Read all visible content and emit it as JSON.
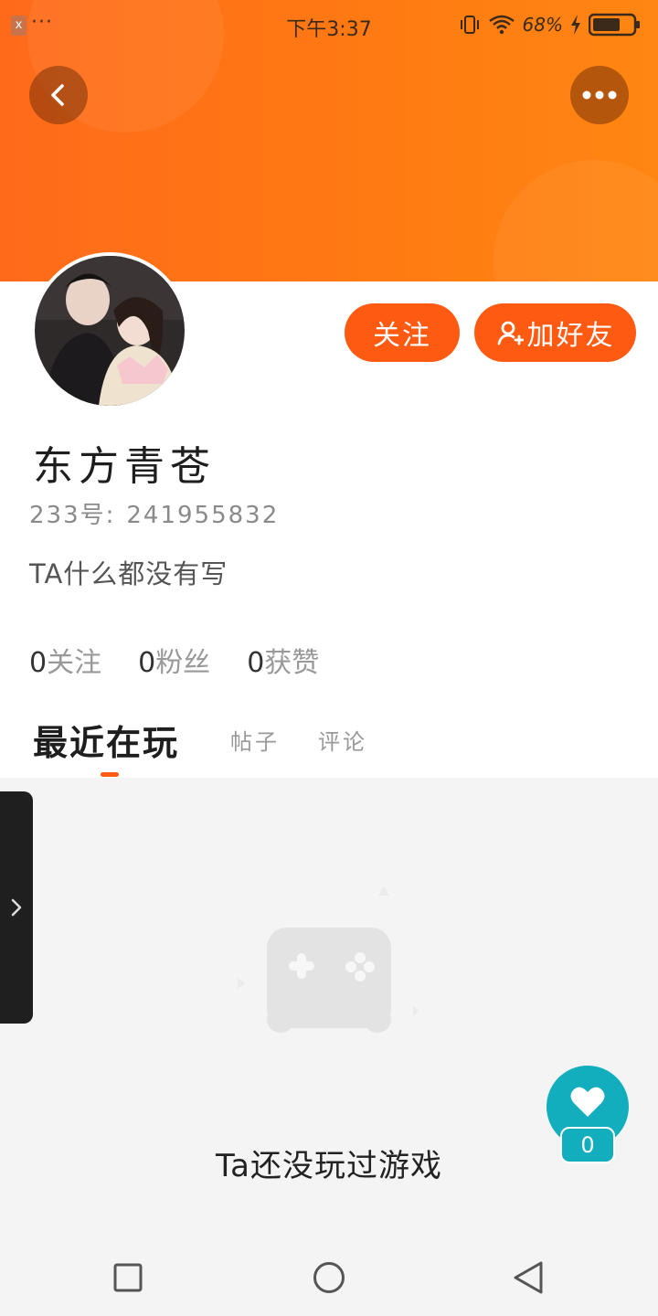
{
  "status_bar": {
    "app_icon": "x",
    "dots": "···",
    "time": "下午3:37",
    "battery": "68%",
    "icons": [
      "vibrate-icon",
      "wifi-icon",
      "bolt-icon",
      "battery-icon"
    ]
  },
  "header": {
    "back_icon": "chevron-left-icon",
    "more_icon": "more-dots-icon",
    "gradient": [
      "#ff6a1a",
      "#ff8612"
    ]
  },
  "profile": {
    "name": "东方青苍",
    "id_label": "233号:",
    "id_value": "241955832",
    "bio": "TA什么都没有写",
    "follow_label": "关注",
    "add_friend_label": "加好友",
    "accent": "#ff5a12"
  },
  "stats": [
    {
      "num": "0",
      "label": "关注"
    },
    {
      "num": "0",
      "label": "粉丝"
    },
    {
      "num": "0",
      "label": "获赞"
    }
  ],
  "tabs": [
    {
      "label": "最近在玩",
      "active": true
    },
    {
      "label": "帖子",
      "active": false
    },
    {
      "label": "评论",
      "active": false
    }
  ],
  "content": {
    "empty_text": "Ta还没玩过游戏",
    "empty_icon": "gamepad-icon"
  },
  "like": {
    "count": "0",
    "color": "#13aebd"
  },
  "nav_bar": {
    "items": [
      "recent-apps-icon",
      "home-icon",
      "back-triangle-icon"
    ]
  }
}
